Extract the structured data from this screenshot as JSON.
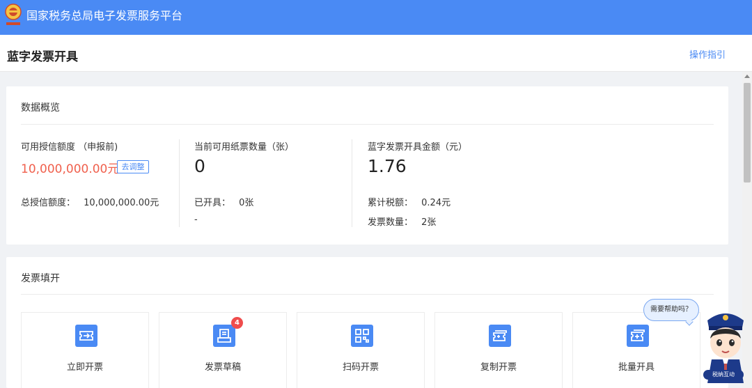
{
  "header": {
    "title": "国家税务总局电子发票服务平台",
    "logo_icon": "tax-emblem-icon",
    "brand_color": "#4a8af4"
  },
  "page": {
    "title": "蓝字发票开具",
    "guide_link": "操作指引"
  },
  "overview": {
    "header": "数据概览",
    "credit": {
      "label": "可用授信额度 （申报前)",
      "value": "10,000,000.00元",
      "adjust_button": "去调整",
      "total_label": "总授信额度：",
      "total_value": "10,000,000.00元"
    },
    "paper": {
      "label": "当前可用纸票数量（张）",
      "value": "0",
      "issued_label": "已开具：",
      "issued_value": "0张",
      "extra": "-"
    },
    "blue": {
      "label": "蓝字发票开具金额（元）",
      "value": "1.76",
      "tax_label": "累计税额：",
      "tax_value": "0.24元",
      "count_label": "发票数量：",
      "count_value": "2张"
    }
  },
  "fill": {
    "header": "发票填开",
    "tiles": [
      {
        "label": "立即开票",
        "icon": "ticket-arrow-icon"
      },
      {
        "label": "发票草稿",
        "icon": "draft-doc-icon",
        "badge": "4"
      },
      {
        "label": "扫码开票",
        "icon": "qr-code-icon"
      },
      {
        "label": "复制开票",
        "icon": "copy-ticket-icon"
      },
      {
        "label": "批量开具",
        "icon": "batch-ticket-icon"
      }
    ]
  },
  "assistant": {
    "bubble": "需要帮助吗？",
    "tag": "税纳互动",
    "icon": "officer-avatar-icon"
  }
}
